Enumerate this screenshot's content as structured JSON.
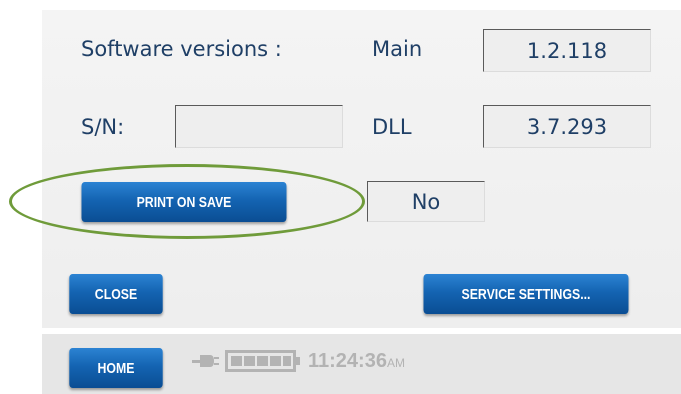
{
  "software": {
    "label": "Software versions :",
    "main_label": "Main",
    "main_value": "1.2.118",
    "dll_label": "DLL",
    "dll_value": "3.7.293"
  },
  "serial": {
    "label": "S/N:",
    "value": ""
  },
  "print_on_save": {
    "button_label": "PRINT ON SAVE",
    "value": "No"
  },
  "buttons": {
    "close": "CLOSE",
    "service_settings": "SERVICE SETTINGS...",
    "home": "HOME"
  },
  "statusbar": {
    "time": "11:24:36",
    "ampm": "AM",
    "icons": [
      "plug-icon",
      "battery-icon"
    ]
  },
  "colors": {
    "label_text": "#1f3f66",
    "button_blue": "#1464b2",
    "highlight_oval": "#6f9b3a",
    "status_gray": "#b3b3b3"
  }
}
